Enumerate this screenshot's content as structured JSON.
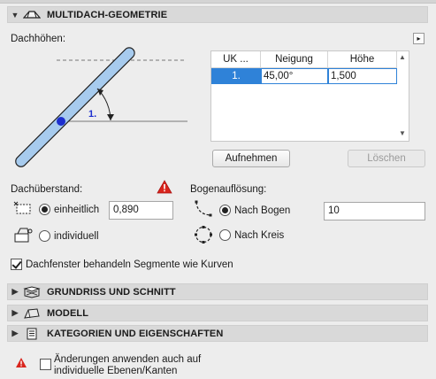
{
  "header": {
    "multidach_title": "MULTIDACH-GEOMETRIE"
  },
  "dachhoehen": {
    "label": "Dachhöhen:",
    "diagram_level_label": "1.",
    "table": {
      "columns": [
        "UK ...",
        "Neigung",
        "Höhe"
      ],
      "rows": [
        {
          "uk": "1.",
          "neigung": "45,00°",
          "hoehe": "1,500"
        }
      ]
    },
    "add_button": "Aufnehmen",
    "delete_button": "Löschen"
  },
  "overhang": {
    "label": "Dachüberstand:",
    "uniform_label": "einheitlich",
    "uniform_selected": true,
    "uniform_value": "0,890",
    "individual_label": "individuell"
  },
  "arc": {
    "label": "Bogenauflösung:",
    "by_arc_label": "Nach Bogen",
    "by_arc_selected": true,
    "by_arc_value": "10",
    "by_circle_label": "Nach Kreis"
  },
  "dormer": {
    "label": "Dachfenster behandeln Segmente wie Kurven",
    "checked": true
  },
  "sections": {
    "grundriss": "GRUNDRISS UND SCHNITT",
    "modell": "MODELL",
    "kategorien": "KATEGORIEN UND EIGENSCHAFTEN"
  },
  "footer": {
    "apply_label_line1": "Änderungen anwenden auch auf",
    "apply_label_line2": "individuelle Ebenen/Kanten",
    "checked": false
  },
  "colors": {
    "selection_blue": "#2f82d8",
    "warning_red": "#d9251d",
    "roof_blue": "#9fc6ee",
    "pivot_blue": "#1d2fcf"
  }
}
